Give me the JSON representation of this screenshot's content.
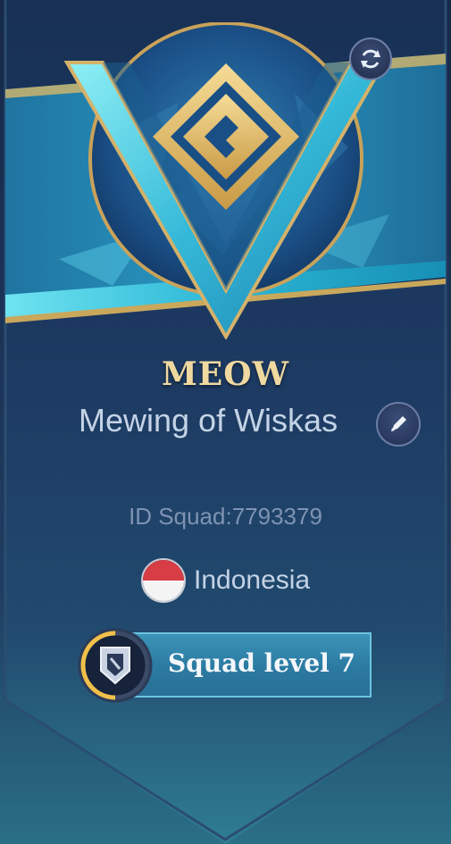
{
  "squad": {
    "name": "MEOW",
    "full_name": "Mewing of Wiskas",
    "id_text": "ID Squad:7793379",
    "country": "Indonesia",
    "level_label": "Squad level 7",
    "level_progress": 0.5
  },
  "icons": {
    "refresh": "refresh-icon",
    "edit": "pencil-icon",
    "flag": "indonesia-flag-icon",
    "level_badge": "shield-icon",
    "emblem": "squad-emblem-icon"
  },
  "colors": {
    "gold": "#f0d9a0",
    "accent_cyan": "#6cc3e0",
    "flag_red": "#d83c44",
    "flag_white": "#f4f4f4"
  }
}
